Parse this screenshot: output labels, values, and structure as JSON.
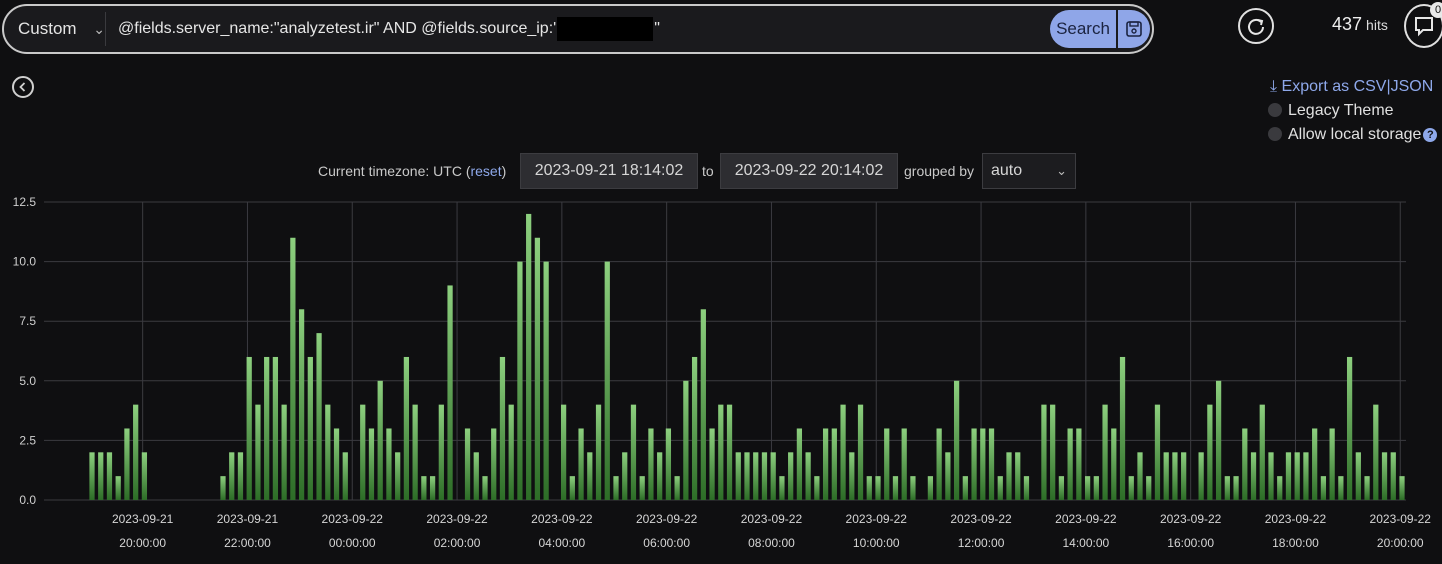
{
  "query_bar": {
    "mode": "Custom",
    "query_prefix": "@fields.server_name:\"analyzetest.ir\" AND @fields.source_ip:'",
    "query_suffix": "\"",
    "search_label": "Search"
  },
  "header": {
    "hits_count": "437",
    "hits_label": "hits",
    "notification_count": "0"
  },
  "options": {
    "export_label": "Export as CSV|JSON",
    "legacy_theme": "Legacy Theme",
    "local_storage": "Allow local storage"
  },
  "time": {
    "tz_prefix": "Current timezone: UTC (",
    "tz_reset": "reset",
    "tz_suffix": ")",
    "from": "2023-09-21 18:14:02",
    "to_label": "to",
    "to": "2023-09-22 20:14:02",
    "grouped_label": "grouped by",
    "grouping": "auto"
  },
  "colors": {
    "bar_top": "#8dd07f",
    "bar_bottom": "#2d6d27",
    "accent": "#8ea8ea"
  },
  "chart_data": {
    "type": "bar",
    "ylim": [
      0,
      12.5
    ],
    "yticks": [
      "0.0",
      "2.5",
      "5.0",
      "7.5",
      "10.0",
      "12.5"
    ],
    "bin_minutes": 10,
    "values": [
      2,
      2,
      2,
      1,
      3,
      4,
      2,
      0,
      0,
      0,
      0,
      0,
      0,
      0,
      0,
      1,
      2,
      2,
      6,
      4,
      6,
      6,
      4,
      11,
      8,
      6,
      7,
      4,
      3,
      2,
      0,
      4,
      3,
      5,
      3,
      2,
      6,
      4,
      1,
      1,
      4,
      9,
      0,
      3,
      2,
      1,
      3,
      6,
      4,
      10,
      12,
      11,
      10,
      0,
      4,
      1,
      3,
      2,
      4,
      10,
      1,
      2,
      4,
      1,
      3,
      2,
      3,
      1,
      5,
      6,
      8,
      3,
      4,
      4,
      2,
      2,
      2,
      2,
      2,
      1,
      2,
      3,
      2,
      1,
      3,
      3,
      4,
      2,
      4,
      1,
      1,
      3,
      1,
      3,
      1,
      0,
      1,
      3,
      2,
      5,
      1,
      3,
      3,
      3,
      1,
      2,
      2,
      1,
      0,
      4,
      4,
      1,
      3,
      3,
      1,
      1,
      4,
      3,
      6,
      1,
      2,
      1,
      4,
      2,
      2,
      2,
      0,
      2,
      4,
      5,
      1,
      1,
      3,
      2,
      4,
      2,
      1,
      2,
      2,
      2,
      3,
      1,
      3,
      1,
      6,
      2,
      1,
      4,
      2,
      2,
      1
    ],
    "x_tick_labels": [
      {
        "date": "2023-09-21",
        "time": "20:00:00"
      },
      {
        "date": "2023-09-21",
        "time": "22:00:00"
      },
      {
        "date": "2023-09-22",
        "time": "00:00:00"
      },
      {
        "date": "2023-09-22",
        "time": "02:00:00"
      },
      {
        "date": "2023-09-22",
        "time": "04:00:00"
      },
      {
        "date": "2023-09-22",
        "time": "06:00:00"
      },
      {
        "date": "2023-09-22",
        "time": "08:00:00"
      },
      {
        "date": "2023-09-22",
        "time": "10:00:00"
      },
      {
        "date": "2023-09-22",
        "time": "12:00:00"
      },
      {
        "date": "2023-09-22",
        "time": "14:00:00"
      },
      {
        "date": "2023-09-22",
        "time": "16:00:00"
      },
      {
        "date": "2023-09-22",
        "time": "18:00:00"
      },
      {
        "date": "2023-09-22",
        "time": "20:00:00"
      }
    ]
  }
}
